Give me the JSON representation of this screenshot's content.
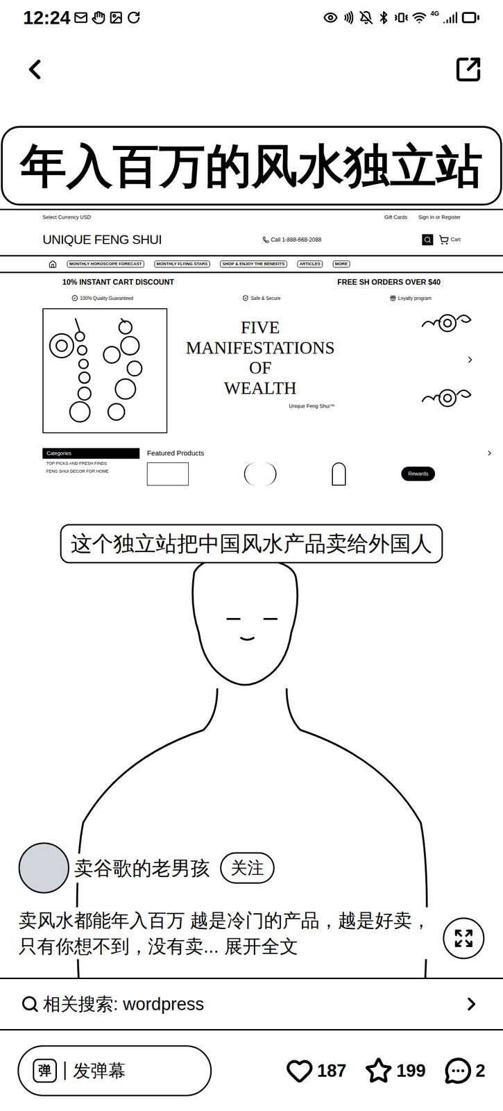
{
  "status_bar": {
    "time": "12:24",
    "network": "4G"
  },
  "video": {
    "title": "年入百万的风水独立站",
    "caption": "这个独立站把中国风水产品卖给外国人",
    "website": {
      "currency": "Select Currency USD",
      "top_links": [
        "Gift Cards",
        "Sign In or Register"
      ],
      "logo": "UNIQUE FENG SHUI",
      "phone": "Call 1-888-668-2088",
      "cart": "Cart",
      "nav": [
        "MONTHLY HOROSCOPE FORECAST",
        "MONTHLY FLYING STARS",
        "SHOP & ENJOY THE BENEFITS",
        "ARTICLES",
        "MORE"
      ],
      "promos": [
        "10% INSTANT CART DISCOUNT",
        "FREE SH ORDERS OVER $40"
      ],
      "badges": [
        "100% Quality Guaranteed",
        "Safe & Secure",
        "Loyalty program"
      ],
      "banner_title": [
        "FIVE",
        "MANIFESTATIONS",
        "OF",
        "WEALTH"
      ],
      "banner_brand": "Unique Feng Shui™",
      "categories_title": "Categories",
      "categories": [
        "TOP PICKS AND FRESH FINDS",
        "FENG SHUI DECOR FOR HOME"
      ],
      "featured": "Featured Products",
      "rewards": "Rewards"
    }
  },
  "author": {
    "name": "卖谷歌的老男孩",
    "follow": "关注",
    "following": false
  },
  "description": {
    "text": "卖风水都能年入百万 越是冷门的产品，越是好卖，只有你想不到，没有卖...",
    "expand": "展开全文"
  },
  "related_search": {
    "label": "相关搜索: wordpress"
  },
  "actions": {
    "danmaku_icon": "弹",
    "danmaku": "发弹幕",
    "likes": "187",
    "favorites": "199",
    "comments": "2"
  }
}
